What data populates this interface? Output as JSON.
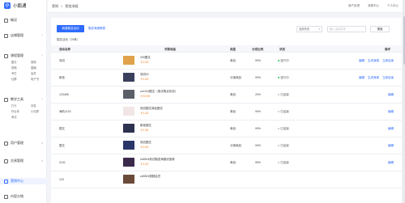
{
  "app": {
    "logo_mark": "小",
    "name": "小鹅通"
  },
  "sidebar": {
    "items": [
      {
        "label": "概况"
      },
      {
        "label": "店铺管理",
        "arrow": "^"
      },
      {
        "label": "课程管理",
        "arrow": "^",
        "subs": [
          "图文",
          "音频",
          "视频",
          "直播",
          "专栏",
          "会员",
          "社群",
          "电子书"
        ]
      },
      {
        "label": "教学工具",
        "arrow": "^",
        "subs": [
          "打卡",
          "问答",
          "作业本",
          "小社群",
          "考试"
        ]
      },
      {
        "label": "用户管理",
        "arrow": "v"
      },
      {
        "label": "交易管理",
        "arrow": "v"
      },
      {
        "label": "营销中心"
      },
      {
        "label": "内容分销"
      }
    ]
  },
  "topbar": {
    "breadcrumb": [
      "营销",
      ">",
      "裂变海报"
    ],
    "links": [
      "用户反馈",
      "消息中心",
      "个人中心"
    ]
  },
  "toolbar": {
    "new_button": "新建裂变活动",
    "help_link": "裂变海报教程",
    "status_select": "全部状态",
    "search_placeholder": "输入活动名称",
    "search_button": "搜索",
    "count_label": "裂变活动（26条）"
  },
  "table": {
    "headers": [
      "活动名称",
      "关联商品",
      "类型",
      "分成比例",
      "状态",
      "操作"
    ],
    "rows": [
      {
        "name": "测试",
        "product": "200图文",
        "price": "￥2.00",
        "type": "单品",
        "ratio": "99%",
        "status": "进行中",
        "actions": [
          "编辑",
          "生成海报",
          "立即结束"
        ],
        "thumb": "#e0a24a",
        "dot": "#34c759"
      },
      {
        "name": "新依",
        "product": "测试01",
        "price": "￥1.00",
        "type": "分销商品",
        "ratio": "99%",
        "status": "进行中",
        "actions": [
          "编辑",
          "生成海报",
          "立即结束"
        ],
        "thumb": "#3a3f5c",
        "dot": "#34c759"
      },
      {
        "name": "123456",
        "product": "zz1313图文（测试购买状态）",
        "price": "￥10.00",
        "type": "单品",
        "ratio": "20%",
        "status": "已结束",
        "actions": [
          "编辑"
        ],
        "thumb": "#5a5f68",
        "dot": "#c0c4cc"
      },
      {
        "name": "海豹1130",
        "product": "测试图文商品图文",
        "price": "￥1.20",
        "type": "单品",
        "ratio": "99%",
        "status": "已结束",
        "actions": [
          "编辑"
        ],
        "thumb": "#f1e5e5",
        "dot": "#c0c4cc"
      },
      {
        "name": "图文",
        "product": "新依图文",
        "price": "￥1.50",
        "type": "单品",
        "ratio": "99%",
        "status": "已结束",
        "actions": [
          "编辑"
        ],
        "thumb": "#2c3250",
        "dot": "#c0c4cc"
      },
      {
        "name": "图文",
        "product": "测试图文",
        "price": "￥1.50",
        "type": "分销商品",
        "ratio": "99%",
        "status": "已结束",
        "actions": [
          "编辑"
        ],
        "thumb": "#2a3568",
        "dot": "#c0c4cc"
      },
      {
        "name": "3131",
        "product": "zx5524测试裂变海报优惠券",
        "price": "￥1.20",
        "type": "单品",
        "ratio": "95%",
        "status": "已结束",
        "actions": [
          "编辑"
        ],
        "thumb": "#3b2a4a",
        "dot": "#c0c4cc"
      },
      {
        "name": "123",
        "product": "zx5524视频会员",
        "price": "",
        "type": "",
        "ratio": "",
        "status": "",
        "actions": [],
        "thumb": "#6b4a3a",
        "dot": "#c0c4cc"
      }
    ]
  }
}
